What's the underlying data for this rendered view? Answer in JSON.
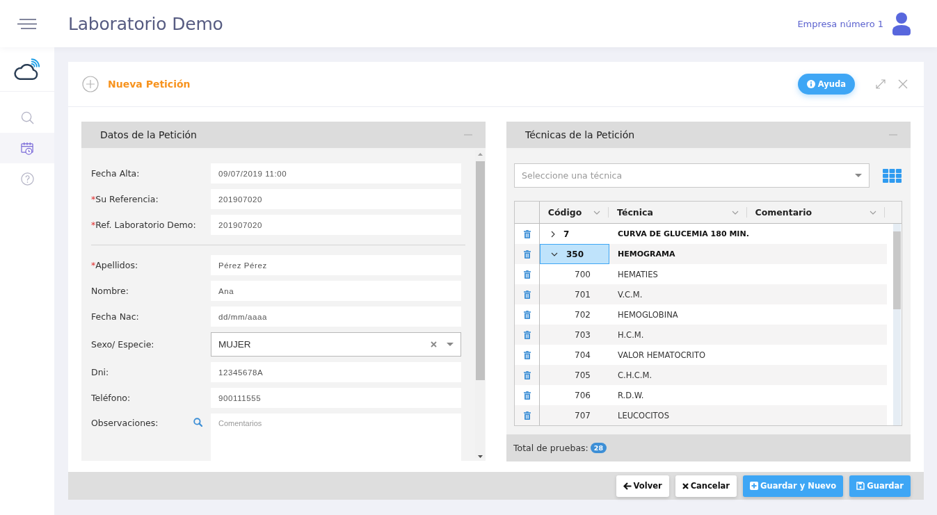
{
  "header": {
    "title": "Laboratorio Demo",
    "company": "Empresa número 1"
  },
  "sidebar": {
    "items": [
      {
        "kind": "search",
        "selected": false
      },
      {
        "kind": "calendar",
        "selected": true
      },
      {
        "kind": "help",
        "selected": false
      }
    ]
  },
  "dialog": {
    "title": "Nueva Petición",
    "help_button": "Ayuda"
  },
  "request_panel": {
    "title": "Datos de la Petición",
    "groups": [
      [
        {
          "label": "Fecha Alta:",
          "kind": "text",
          "value": "09/07/2019 11:00",
          "lookup": false
        },
        {
          "mark": "*",
          "label": "Su Referencia:",
          "kind": "text",
          "value": "201907020",
          "lookup": false
        },
        {
          "mark": "*",
          "label": "Ref. Laboratorio Demo:",
          "kind": "text",
          "value": "201907020",
          "lookup": false
        }
      ],
      [
        {
          "mark": "*",
          "label": "Apellidos:",
          "kind": "text",
          "value": "Pérez Pérez",
          "lookup": false
        },
        {
          "label": "Nombre:",
          "kind": "text",
          "value": "Ana",
          "lookup": false
        },
        {
          "label": "Fecha Nac:",
          "kind": "date",
          "placeholder": "dd/mm/aaaa",
          "lookup": false
        },
        {
          "label": "Sexo/ Especie:",
          "kind": "select",
          "value": "MUJER",
          "lookup": false
        },
        {
          "label": "Dni:",
          "kind": "text",
          "value": "12345678A",
          "lookup": false
        },
        {
          "label": "Teléfono:",
          "kind": "text",
          "value": "900111555",
          "lookup": false
        },
        {
          "label": "Observaciones:",
          "kind": "textarea",
          "placeholder": "Comentarios",
          "lookup": true
        }
      ]
    ]
  },
  "techniques_panel": {
    "title": "Técnicas de la Petición",
    "select": {
      "placeholder": "Seleccione una técnica"
    },
    "table": {
      "columns": [
        "Código",
        "Técnica",
        "Comentario"
      ],
      "rows": [
        {
          "code": "7",
          "name": "CURVA DE GLUCEMIA 180 MIN.",
          "expanded": false,
          "selected": false
        },
        {
          "code": "350",
          "name": "HEMOGRAMA",
          "expanded": true,
          "selected": true,
          "children": [
            {
              "code": "700",
              "name": "HEMATIES",
              "selected": false
            },
            {
              "code": "701",
              "name": "V.C.M.",
              "selected": false
            },
            {
              "code": "702",
              "name": "HEMOGLOBINA",
              "selected": false
            },
            {
              "code": "703",
              "name": "H.C.M.",
              "selected": false
            },
            {
              "code": "704",
              "name": "VALOR HEMATOCRITO",
              "selected": false
            },
            {
              "code": "705",
              "name": "C.H.C.M.",
              "selected": false
            },
            {
              "code": "706",
              "name": "R.D.W.",
              "selected": false
            },
            {
              "code": "707",
              "name": "LEUCOCITOS",
              "selected": false
            }
          ]
        }
      ]
    },
    "total_label": "Total de pruebas:",
    "total_count": "28"
  },
  "footer": {
    "buttons": [
      {
        "label": "Volver",
        "kind": "back"
      },
      {
        "label": "Cancelar",
        "kind": "cancel"
      },
      {
        "label": "Guardar y Nuevo",
        "kind": "save_new"
      },
      {
        "label": "Guardar",
        "kind": "save"
      }
    ]
  }
}
